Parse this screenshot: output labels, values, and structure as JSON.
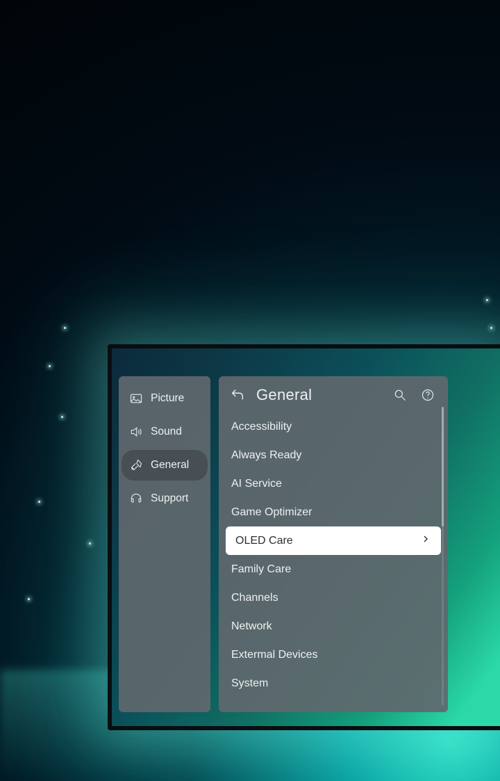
{
  "sidebar": {
    "items": [
      {
        "id": "picture",
        "label": "Picture",
        "icon": "picture-icon",
        "selected": false
      },
      {
        "id": "sound",
        "label": "Sound",
        "icon": "sound-icon",
        "selected": false
      },
      {
        "id": "general",
        "label": "General",
        "icon": "general-icon",
        "selected": true
      },
      {
        "id": "support",
        "label": "Support",
        "icon": "support-icon",
        "selected": false
      }
    ]
  },
  "panel": {
    "title": "General",
    "items": [
      {
        "label": "Accessibility",
        "selected": false
      },
      {
        "label": "Always Ready",
        "selected": false
      },
      {
        "label": "AI Service",
        "selected": false
      },
      {
        "label": "Game Optimizer",
        "selected": false
      },
      {
        "label": "OLED Care",
        "selected": true
      },
      {
        "label": "Family Care",
        "selected": false
      },
      {
        "label": "Channels",
        "selected": false
      },
      {
        "label": "Network",
        "selected": false
      },
      {
        "label": "Extermal Devices",
        "selected": false
      },
      {
        "label": "System",
        "selected": false
      }
    ]
  }
}
